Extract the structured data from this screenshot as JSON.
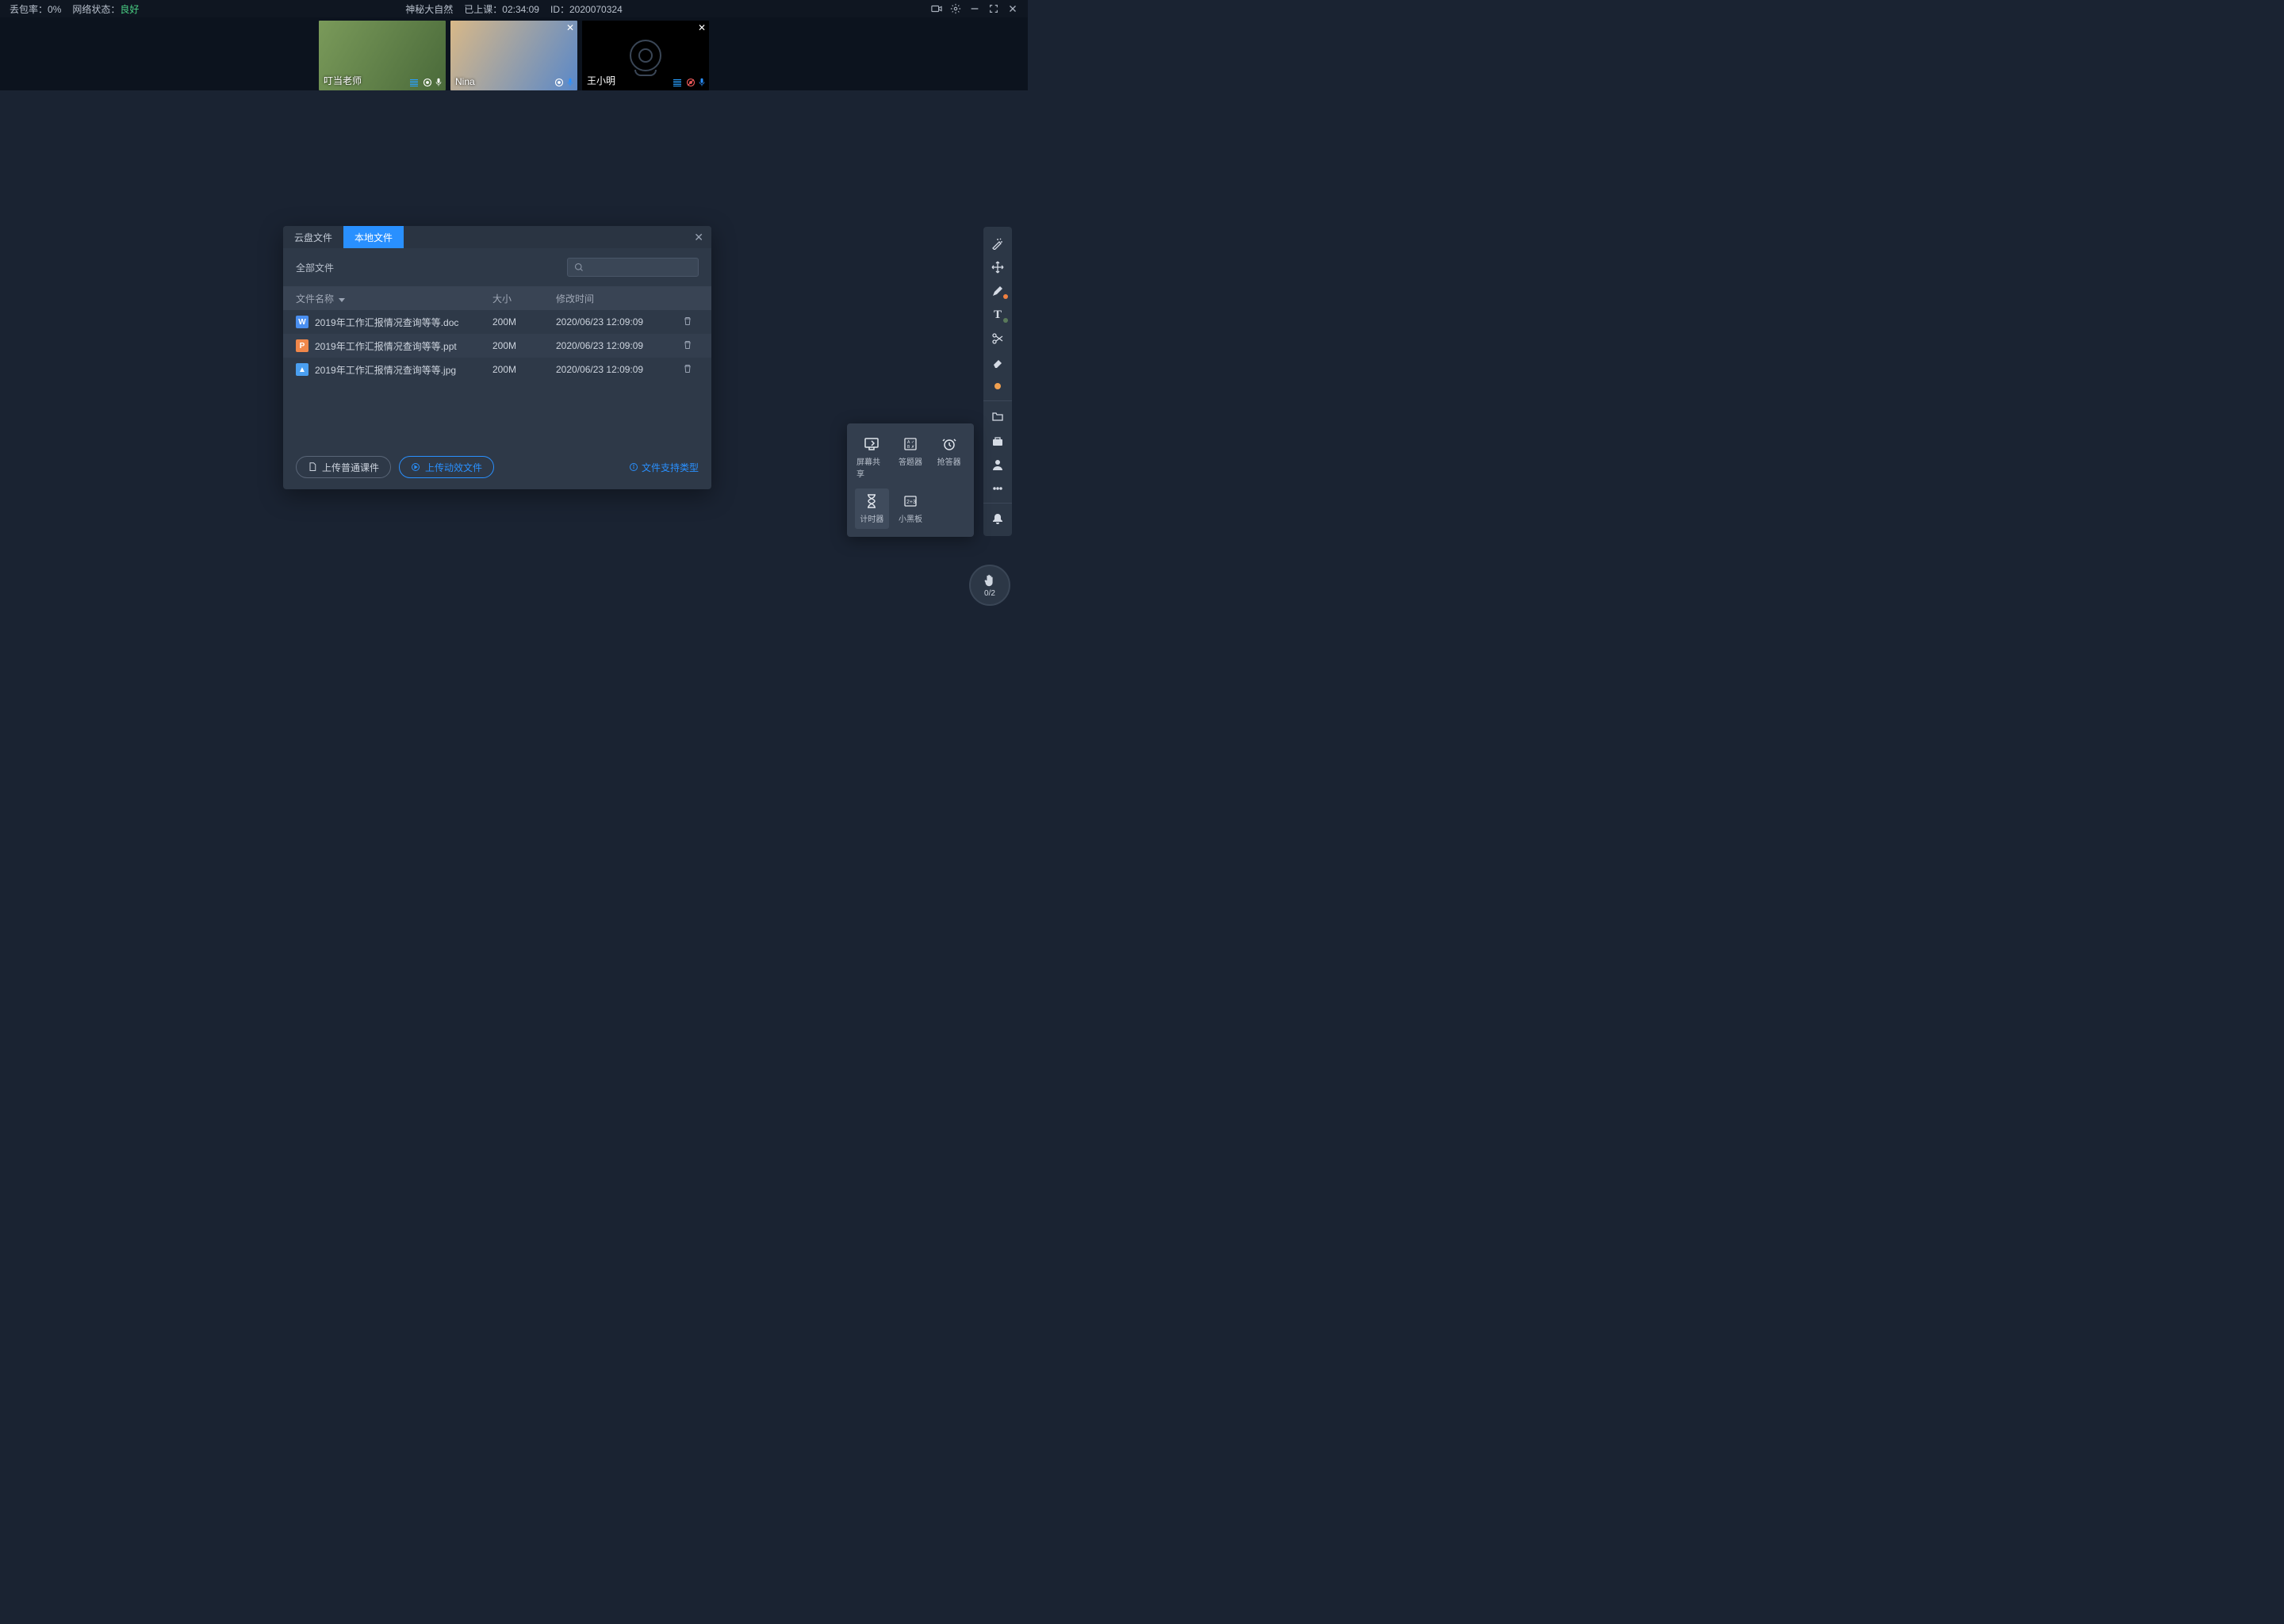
{
  "topbar": {
    "packet_loss_label": "丢包率：",
    "packet_loss_value": "0%",
    "network_label": "网络状态：",
    "network_value": "良好",
    "title": "神秘大自然",
    "duration_label": "已上课：",
    "duration_value": "02:34:09",
    "id_label": "ID：",
    "id_value": "2020070324"
  },
  "participants": [
    {
      "name": "叮当老师",
      "camera_off": false,
      "mic_muted": false
    },
    {
      "name": "Nina",
      "camera_off": false,
      "mic_muted": false
    },
    {
      "name": "王小明",
      "camera_off": true,
      "mic_muted": true
    }
  ],
  "dialog": {
    "tabs": {
      "cloud": "云盘文件",
      "local": "本地文件"
    },
    "close": "✕",
    "all_files": "全部文件",
    "cols": {
      "name": "文件名称",
      "size": "大小",
      "time": "修改时间"
    },
    "files": [
      {
        "type": "W",
        "name": "2019年工作汇报情况查询等等.doc",
        "size": "200M",
        "time": "2020/06/23 12:09:09"
      },
      {
        "type": "P",
        "name": "2019年工作汇报情况查询等等.ppt",
        "size": "200M",
        "time": "2020/06/23 12:09:09"
      },
      {
        "type": "I",
        "glyph": "▲",
        "name": "2019年工作汇报情况查询等等.jpg",
        "size": "200M",
        "time": "2020/06/23 12:09:09"
      }
    ],
    "upload_normal": "上传普通课件",
    "upload_anim": "上传动效文件",
    "support_link": "文件支持类型"
  },
  "pop": {
    "items": [
      {
        "label": "屏幕共享",
        "icon": "screen"
      },
      {
        "label": "答题器",
        "icon": "quiz"
      },
      {
        "label": "抢答器",
        "icon": "alarm"
      },
      {
        "label": "计时器",
        "icon": "timer",
        "selected": true
      },
      {
        "label": "小黑板",
        "icon": "board"
      }
    ]
  },
  "hand": {
    "count": "0/2"
  }
}
